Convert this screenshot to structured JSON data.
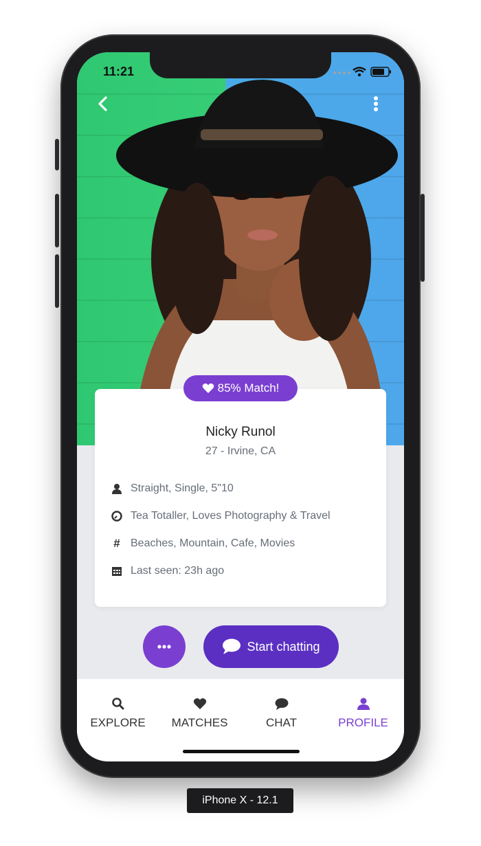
{
  "status_bar": {
    "time": "11:21"
  },
  "profile": {
    "match_label": "85% Match!",
    "name": "Nicky Runol",
    "age_location": "27 - Irvine, CA",
    "details": [
      {
        "icon": "person-icon",
        "text": "Straight, Single, 5\"10"
      },
      {
        "icon": "clock-icon",
        "text": "Tea Totaller, Loves Photography & Travel"
      },
      {
        "icon": "hashtag-icon",
        "text": "Beaches, Mountain, Cafe, Movies"
      },
      {
        "icon": "calendar-icon",
        "text": "Last seen: 23h ago"
      }
    ]
  },
  "actions": {
    "start_chatting": "Start chatting"
  },
  "tabs": [
    {
      "label": "EXPLORE",
      "icon": "search-icon",
      "active": false
    },
    {
      "label": "MATCHES",
      "icon": "heart-icon",
      "active": false
    },
    {
      "label": "CHAT",
      "icon": "chat-icon",
      "active": false
    },
    {
      "label": "PROFILE",
      "icon": "person-icon",
      "active": true
    }
  ],
  "device_label": "iPhone X - 12.1",
  "colors": {
    "accent": "#7a3fd1",
    "accent_dark": "#5a2fc2",
    "muted_text": "#666d78"
  }
}
